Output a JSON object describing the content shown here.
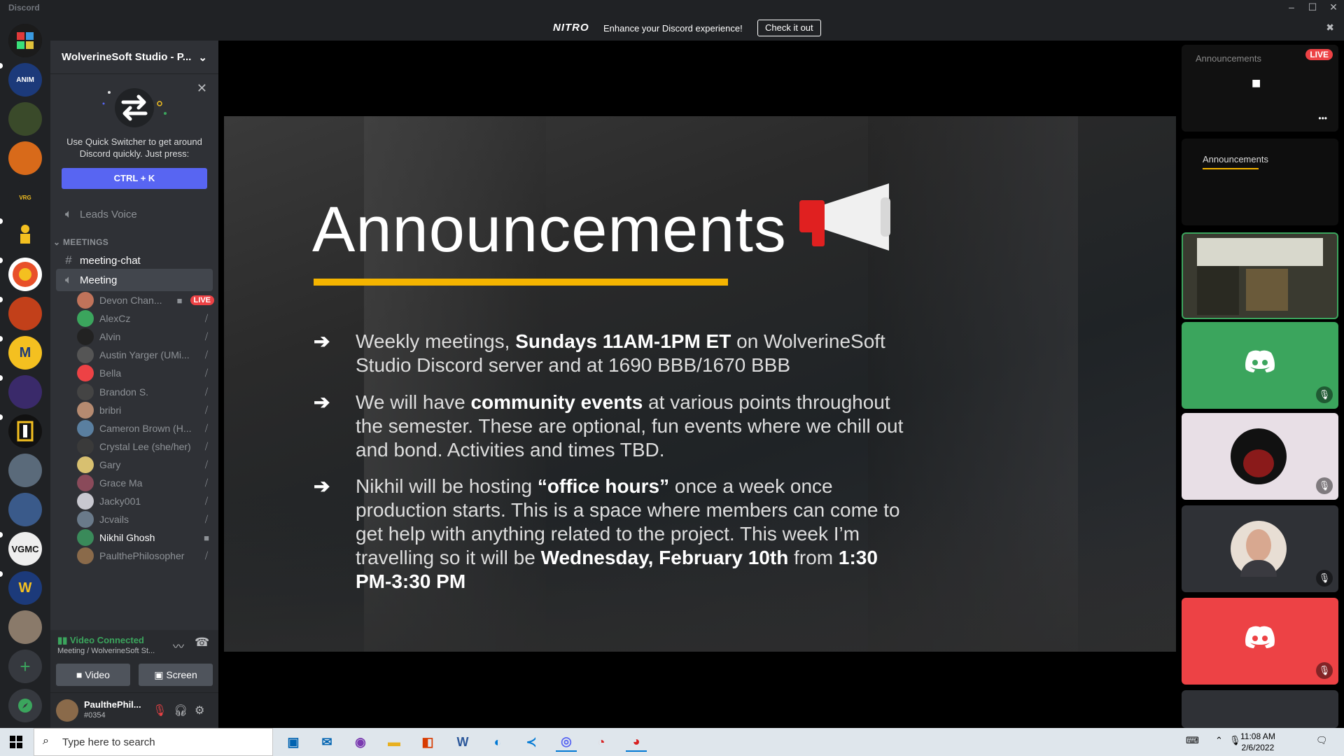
{
  "window": {
    "app_name": "Discord",
    "minimize": "–",
    "maximize": "☐",
    "close": "✕"
  },
  "nitro_banner": {
    "logo": "NITRO",
    "message": "Enhance your Discord experience!",
    "cta": "Check it out",
    "close": "✖"
  },
  "server": {
    "name": "WolverineSoft Studio - P..."
  },
  "quick_switcher": {
    "text": "Use Quick Switcher to get around Discord quickly. Just press:",
    "shortcut": "CTRL + K"
  },
  "channels": {
    "leads_voice": "Leads Voice",
    "category": "MEETINGS",
    "meeting_chat": "meeting-chat",
    "meeting": "Meeting"
  },
  "voice_users": [
    {
      "name": "Devon Chan...",
      "status": "video-live",
      "live": "LIVE",
      "color": "#c0735a"
    },
    {
      "name": "AlexCz",
      "status": "muted",
      "color": "#3ba55d"
    },
    {
      "name": "Alvin",
      "status": "muted",
      "color": "#222222"
    },
    {
      "name": "Austin Yarger (UMi...",
      "status": "muted",
      "color": "#555555"
    },
    {
      "name": "Bella",
      "status": "muted",
      "color": "#ed4245"
    },
    {
      "name": "Brandon S.",
      "status": "muted",
      "color": "#444444"
    },
    {
      "name": "bribri",
      "status": "muted",
      "color": "#b58a70"
    },
    {
      "name": "Cameron Brown (H...",
      "status": "muted",
      "color": "#5a7fa0"
    },
    {
      "name": "Crystal Lee (she/her)",
      "status": "muted",
      "color": "#3a3a3a"
    },
    {
      "name": "Gary",
      "status": "muted",
      "color": "#d8c070"
    },
    {
      "name": "Grace Ma",
      "status": "muted",
      "color": "#8a4a5a"
    },
    {
      "name": "Jacky001",
      "status": "muted",
      "color": "#c8c8d0"
    },
    {
      "name": "Jcvails",
      "status": "muted",
      "color": "#6a7a8a"
    },
    {
      "name": "Nikhil Ghosh",
      "status": "video",
      "color": "#3a8a5a"
    },
    {
      "name": "PaulthePhilosopher",
      "status": "muted",
      "color": "#8a6a4a"
    }
  ],
  "rtc": {
    "status": "Video Connected",
    "sub": "Meeting / WolverineSoft St...",
    "video_label": "Video",
    "screen_label": "Screen"
  },
  "user_panel": {
    "name": "PaulthePhil...",
    "tag": "#0354"
  },
  "slide": {
    "title": "Announcements",
    "bullets": [
      {
        "pre": "Weekly meetings, ",
        "bold": "Sundays 11AM-1PM ET",
        "post": " on WolverineSoft Studio Discord server and at 1690 BBB/1670 BBB"
      },
      {
        "pre": "We will have ",
        "bold": "community events",
        "post": " at various points throughout the semester. These are optional, fun events where we chill out and bond. Activities and times TBD."
      },
      {
        "pre": "Nikhil will be hosting ",
        "bold": "“office hours”",
        "post": " once a week once production starts. This is a space where members can come to get help with anything related to the project. This week I’m travelling so it will be ",
        "bold2": "Wednesday, February 10th",
        "post2": " from ",
        "bold3": "1:30 PM-3:30 PM"
      }
    ]
  },
  "right_tiles": {
    "live_badge": "LIVE",
    "thumb_title": "Announcements",
    "more": "•••"
  },
  "colors": {
    "blurple": "#5865f2",
    "green": "#3ba55d",
    "red": "#ed4245",
    "accent_yellow": "#f4b400"
  },
  "taskbar": {
    "search_placeholder": "Type here to search",
    "time": "11:08 AM",
    "date": "2/6/2022"
  }
}
